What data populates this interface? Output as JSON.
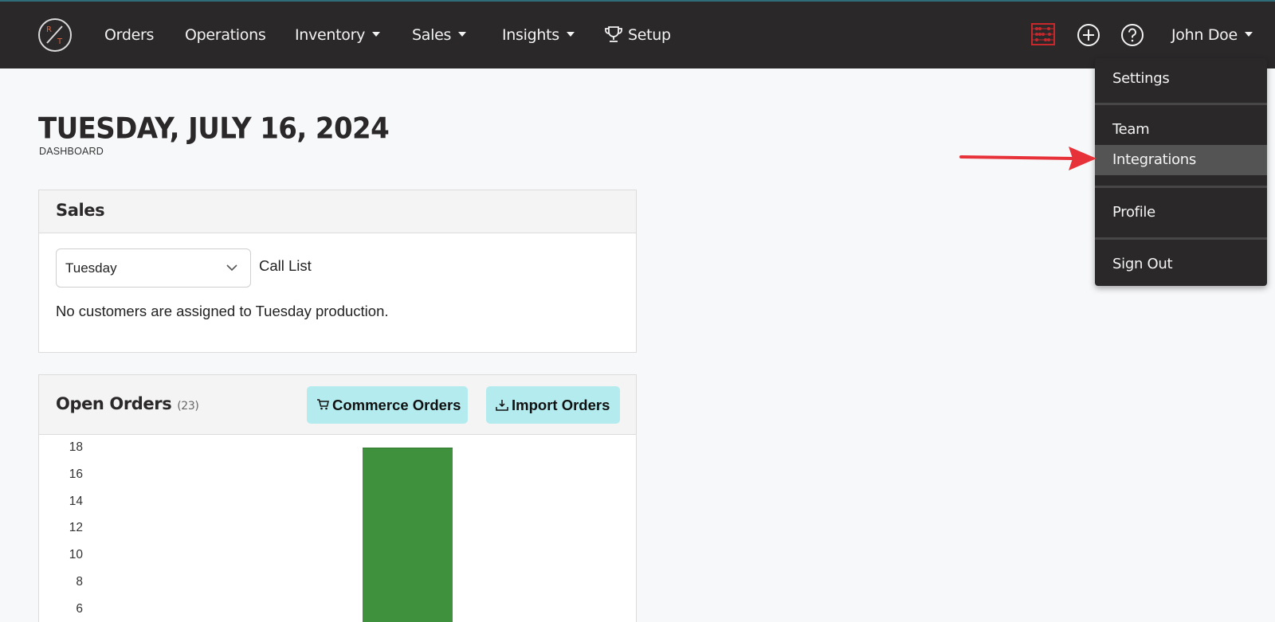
{
  "nav": {
    "logo_letters": [
      "R",
      "T"
    ],
    "items": [
      {
        "label": "Orders",
        "has_caret": false
      },
      {
        "label": "Operations",
        "has_caret": false
      },
      {
        "label": "Inventory",
        "has_caret": true
      },
      {
        "label": "Sales",
        "has_caret": true
      },
      {
        "label": "Insights",
        "has_caret": true
      },
      {
        "label": "Setup",
        "has_caret": false,
        "icon": "trophy-icon"
      }
    ],
    "right_icons": [
      "abacus-icon",
      "add-circle-icon",
      "help-circle-icon"
    ],
    "user_name": "John Doe"
  },
  "user_dropdown": {
    "items": [
      {
        "label": "Settings"
      },
      {
        "label": "Team"
      },
      {
        "label": "Integrations",
        "highlighted": true
      },
      {
        "label": "Profile"
      },
      {
        "label": "Sign Out"
      }
    ]
  },
  "page": {
    "title": "TUESDAY, JULY 16, 2024",
    "subtitle": "DASHBOARD"
  },
  "sales_panel": {
    "title": "Sales",
    "day_select": {
      "value": "Tuesday"
    },
    "call_list_label": "Call List",
    "empty_message": "No customers are assigned to Tuesday production."
  },
  "orders_panel": {
    "title": "Open Orders",
    "count": "(23)",
    "commerce_button": "Commerce Orders",
    "import_button": "Import Orders"
  },
  "chart_data": {
    "type": "bar",
    "values": [
      18
    ],
    "y_ticks": [
      18,
      16,
      14,
      12,
      10,
      8,
      6
    ],
    "color": "#3f913d"
  },
  "colors": {
    "topbar": "#2a2829",
    "dropdown_highlight": "#545454",
    "button_bg": "#b3ebee",
    "bar": "#3f913d",
    "arrow": "#e8323a"
  }
}
